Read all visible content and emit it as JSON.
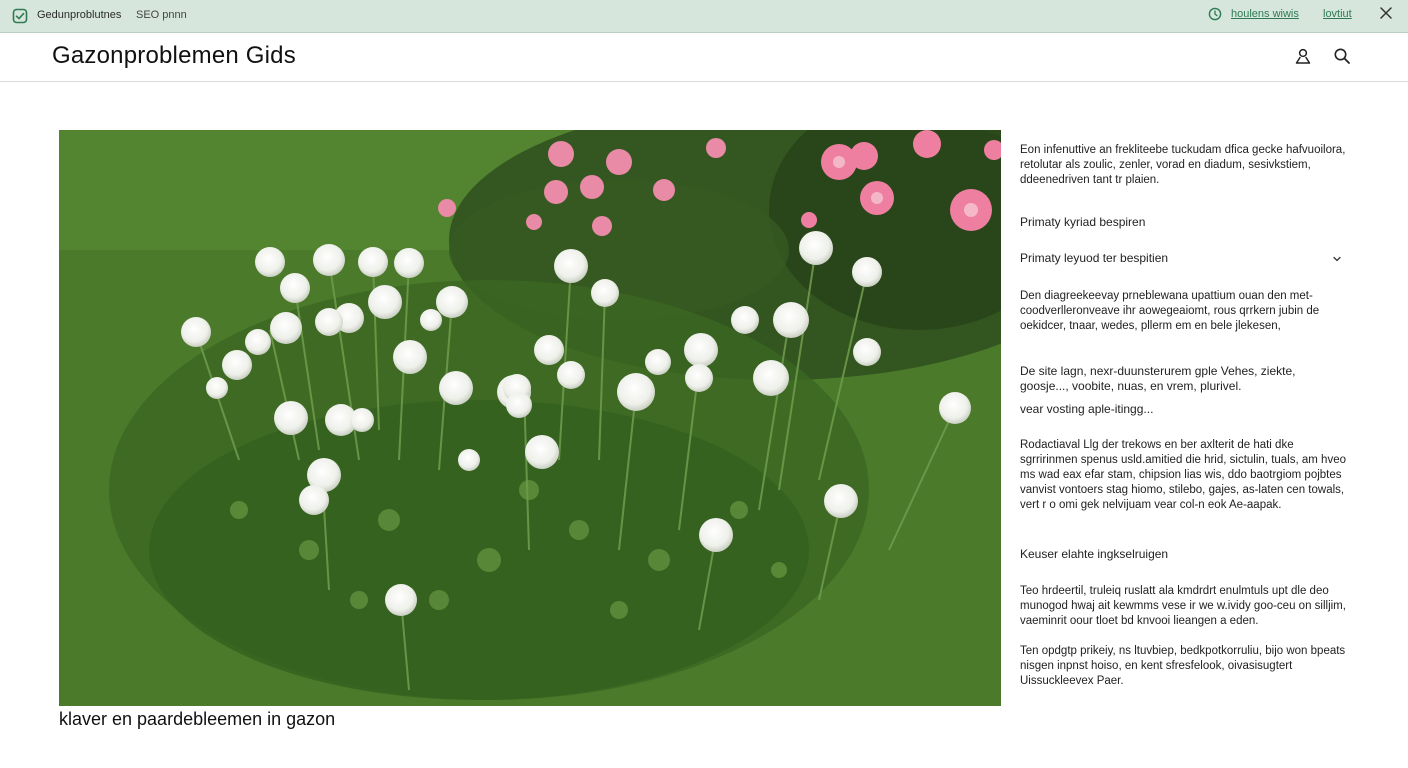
{
  "topbar": {
    "app_name": "Gedunproblutnes",
    "app_sub": "SEO pnnn",
    "link_a": "houlens wiwis",
    "link_b": "lovtiut",
    "icons": {
      "app": "check-shield-icon",
      "status": "clock-icon",
      "close": "close-icon"
    },
    "accent": "#2f7a52",
    "background": "#d6e6dd"
  },
  "header": {
    "title": "Gazonproblemen Gids",
    "icons": {
      "user": "user-icon",
      "search": "search-icon"
    }
  },
  "photo": {
    "caption": "klaver en paardebleemen in gazon"
  },
  "sidebar": {
    "intro": "Eon infenuttive an frekliteebe tuckudam dfica gecke hafvuoilora, retolutar als zoulic, zenler, vorad en diadum, sesivkstiem, ddeenedriven tant tr plaien.",
    "heading_primary": "Primaty kyriad bespiren",
    "dropdown_label": "Primaty leyuod ter bespitien",
    "diag_text": "Den diagreekeevay prneblewana upattium ouan den met-coodverlleronveave ihr aowegeaiomt, rous qrrkern jubin de oekidcer, tnaar, wedes, pllerm em en bele jlekesen,",
    "site_text": "De site lagn, nexr-duunsterurem gple Vehes, ziekte, goosje..., voobite, nuas, en vrem, plurivel.",
    "heading_voor": "vear vosting aple-itingg...",
    "redact_text": "Rodactiaval Llg der trekows en ber axlterit de hati dke sgrririnmen spenus usld.amitied die hrid, sictulin, tuals, am hveo ms wad eax efar stam, chipsion lias wis, ddo baotrgiom pojbtes vanvist vontoers stag hiomo, stilebo, gajes, as-laten cen towals, vert r o omi gek nelvijuam vear col-n eok Ae-aapak.",
    "heading_keuser": "Keuser elahte ingkselruigen",
    "ten1_text": "Teo hrdeertil, truleiq ruslatt ala kmdrdrt enulmtuls upt dle deo munogod hwaj ait kewmms vese ir we w.ividy goo-ceu on silljim, vaeminrit oour tloet bd knvooi lieangen a eden.",
    "ten2_text": "Ten opdgtp prikeiy, ns ltuvbiep, bedkpotkorruliu, bijo won bpeats nisgen inpnst hoiso, en kent sfresfelook, oivasisugtert Uissuckleevex Paer."
  }
}
